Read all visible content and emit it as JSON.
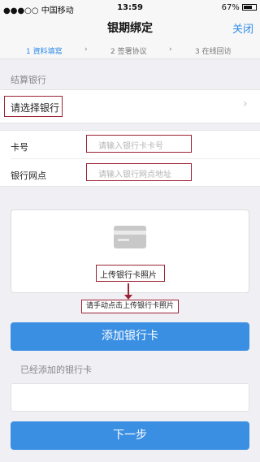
{
  "status": {
    "carrier": "●●●○○ 中国移动",
    "time": "13:59",
    "battery": "67%"
  },
  "nav": {
    "title": "银期绑定",
    "close": "关闭"
  },
  "steps": [
    "1 資料填寫",
    "2 签署协议",
    "3 在线回访"
  ],
  "step_arrow": "›",
  "bank_section": {
    "label": "结算银行",
    "select_bank": "请选择银行"
  },
  "form": {
    "card_label": "卡号",
    "card_placeholder": "请输入银行卡卡号",
    "branch_label": "银行网点",
    "branch_placeholder": "请输入银行网点地址"
  },
  "upload": {
    "label": "上传银行卡照片",
    "hint": "请手动点击上传银行卡照片"
  },
  "buttons": {
    "add_card": "添加银行卡",
    "next": "下一步"
  },
  "added_section": {
    "label": "已经添加的银行卡"
  },
  "colors": {
    "accent": "#2f8bea",
    "button": "#3b8fe3",
    "annotation": "#9b2335"
  }
}
